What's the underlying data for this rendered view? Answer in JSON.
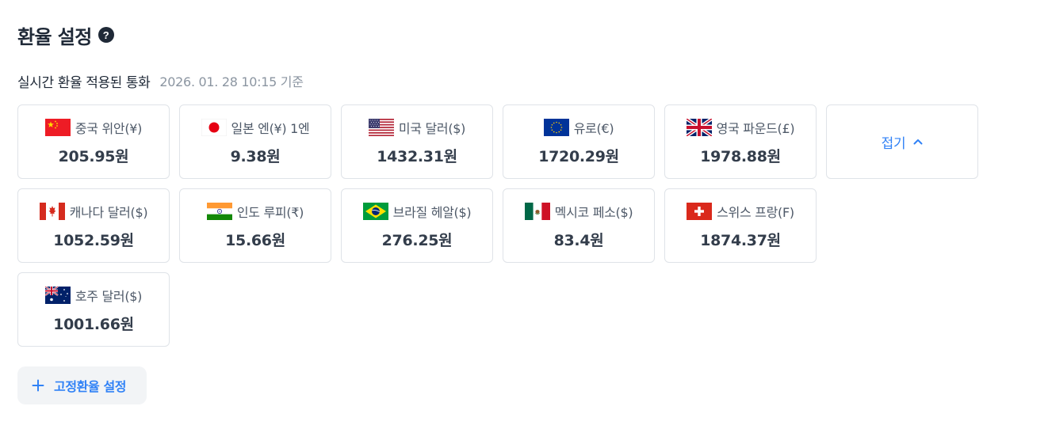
{
  "header": {
    "title": "환율 설정",
    "help_icon": "?"
  },
  "realtime": {
    "label": "실시간 환율 적용된 통화",
    "timestamp": "2026. 01. 28 10:15 기준"
  },
  "currencies": [
    {
      "name": "중국 위안(¥)",
      "rate": "205.95원",
      "flag": "china-flag-icon"
    },
    {
      "name": "일본 엔(¥) 1엔",
      "rate": "9.38원",
      "flag": "japan-flag-icon"
    },
    {
      "name": "미국 달러($)",
      "rate": "1432.31원",
      "flag": "usa-flag-icon"
    },
    {
      "name": "유로(€)",
      "rate": "1720.29원",
      "flag": "eu-flag-icon"
    },
    {
      "name": "영국 파운드(£)",
      "rate": "1978.88원",
      "flag": "uk-flag-icon"
    },
    {
      "name": "캐나다 달러($)",
      "rate": "1052.59원",
      "flag": "canada-flag-icon"
    },
    {
      "name": "인도 루피(₹)",
      "rate": "15.66원",
      "flag": "india-flag-icon"
    },
    {
      "name": "브라질 헤알($)",
      "rate": "276.25원",
      "flag": "brazil-flag-icon"
    },
    {
      "name": "멕시코 페소($)",
      "rate": "83.4원",
      "flag": "mexico-flag-icon"
    },
    {
      "name": "스위스 프랑(F)",
      "rate": "1874.37원",
      "flag": "switzerland-flag-icon"
    },
    {
      "name": "호주 달러($)",
      "rate": "1001.66원",
      "flag": "australia-flag-icon"
    }
  ],
  "collapse": {
    "label": "접기",
    "icon": "chevron-up-icon"
  },
  "fixed_rate_button": {
    "label": "고정환율 설정",
    "icon": "plus-icon"
  },
  "colors": {
    "accent": "#3182f6",
    "text": "#1f2937",
    "muted": "#8b95a1",
    "border": "#dfe3e8",
    "button_bg": "#f2f4f6"
  }
}
